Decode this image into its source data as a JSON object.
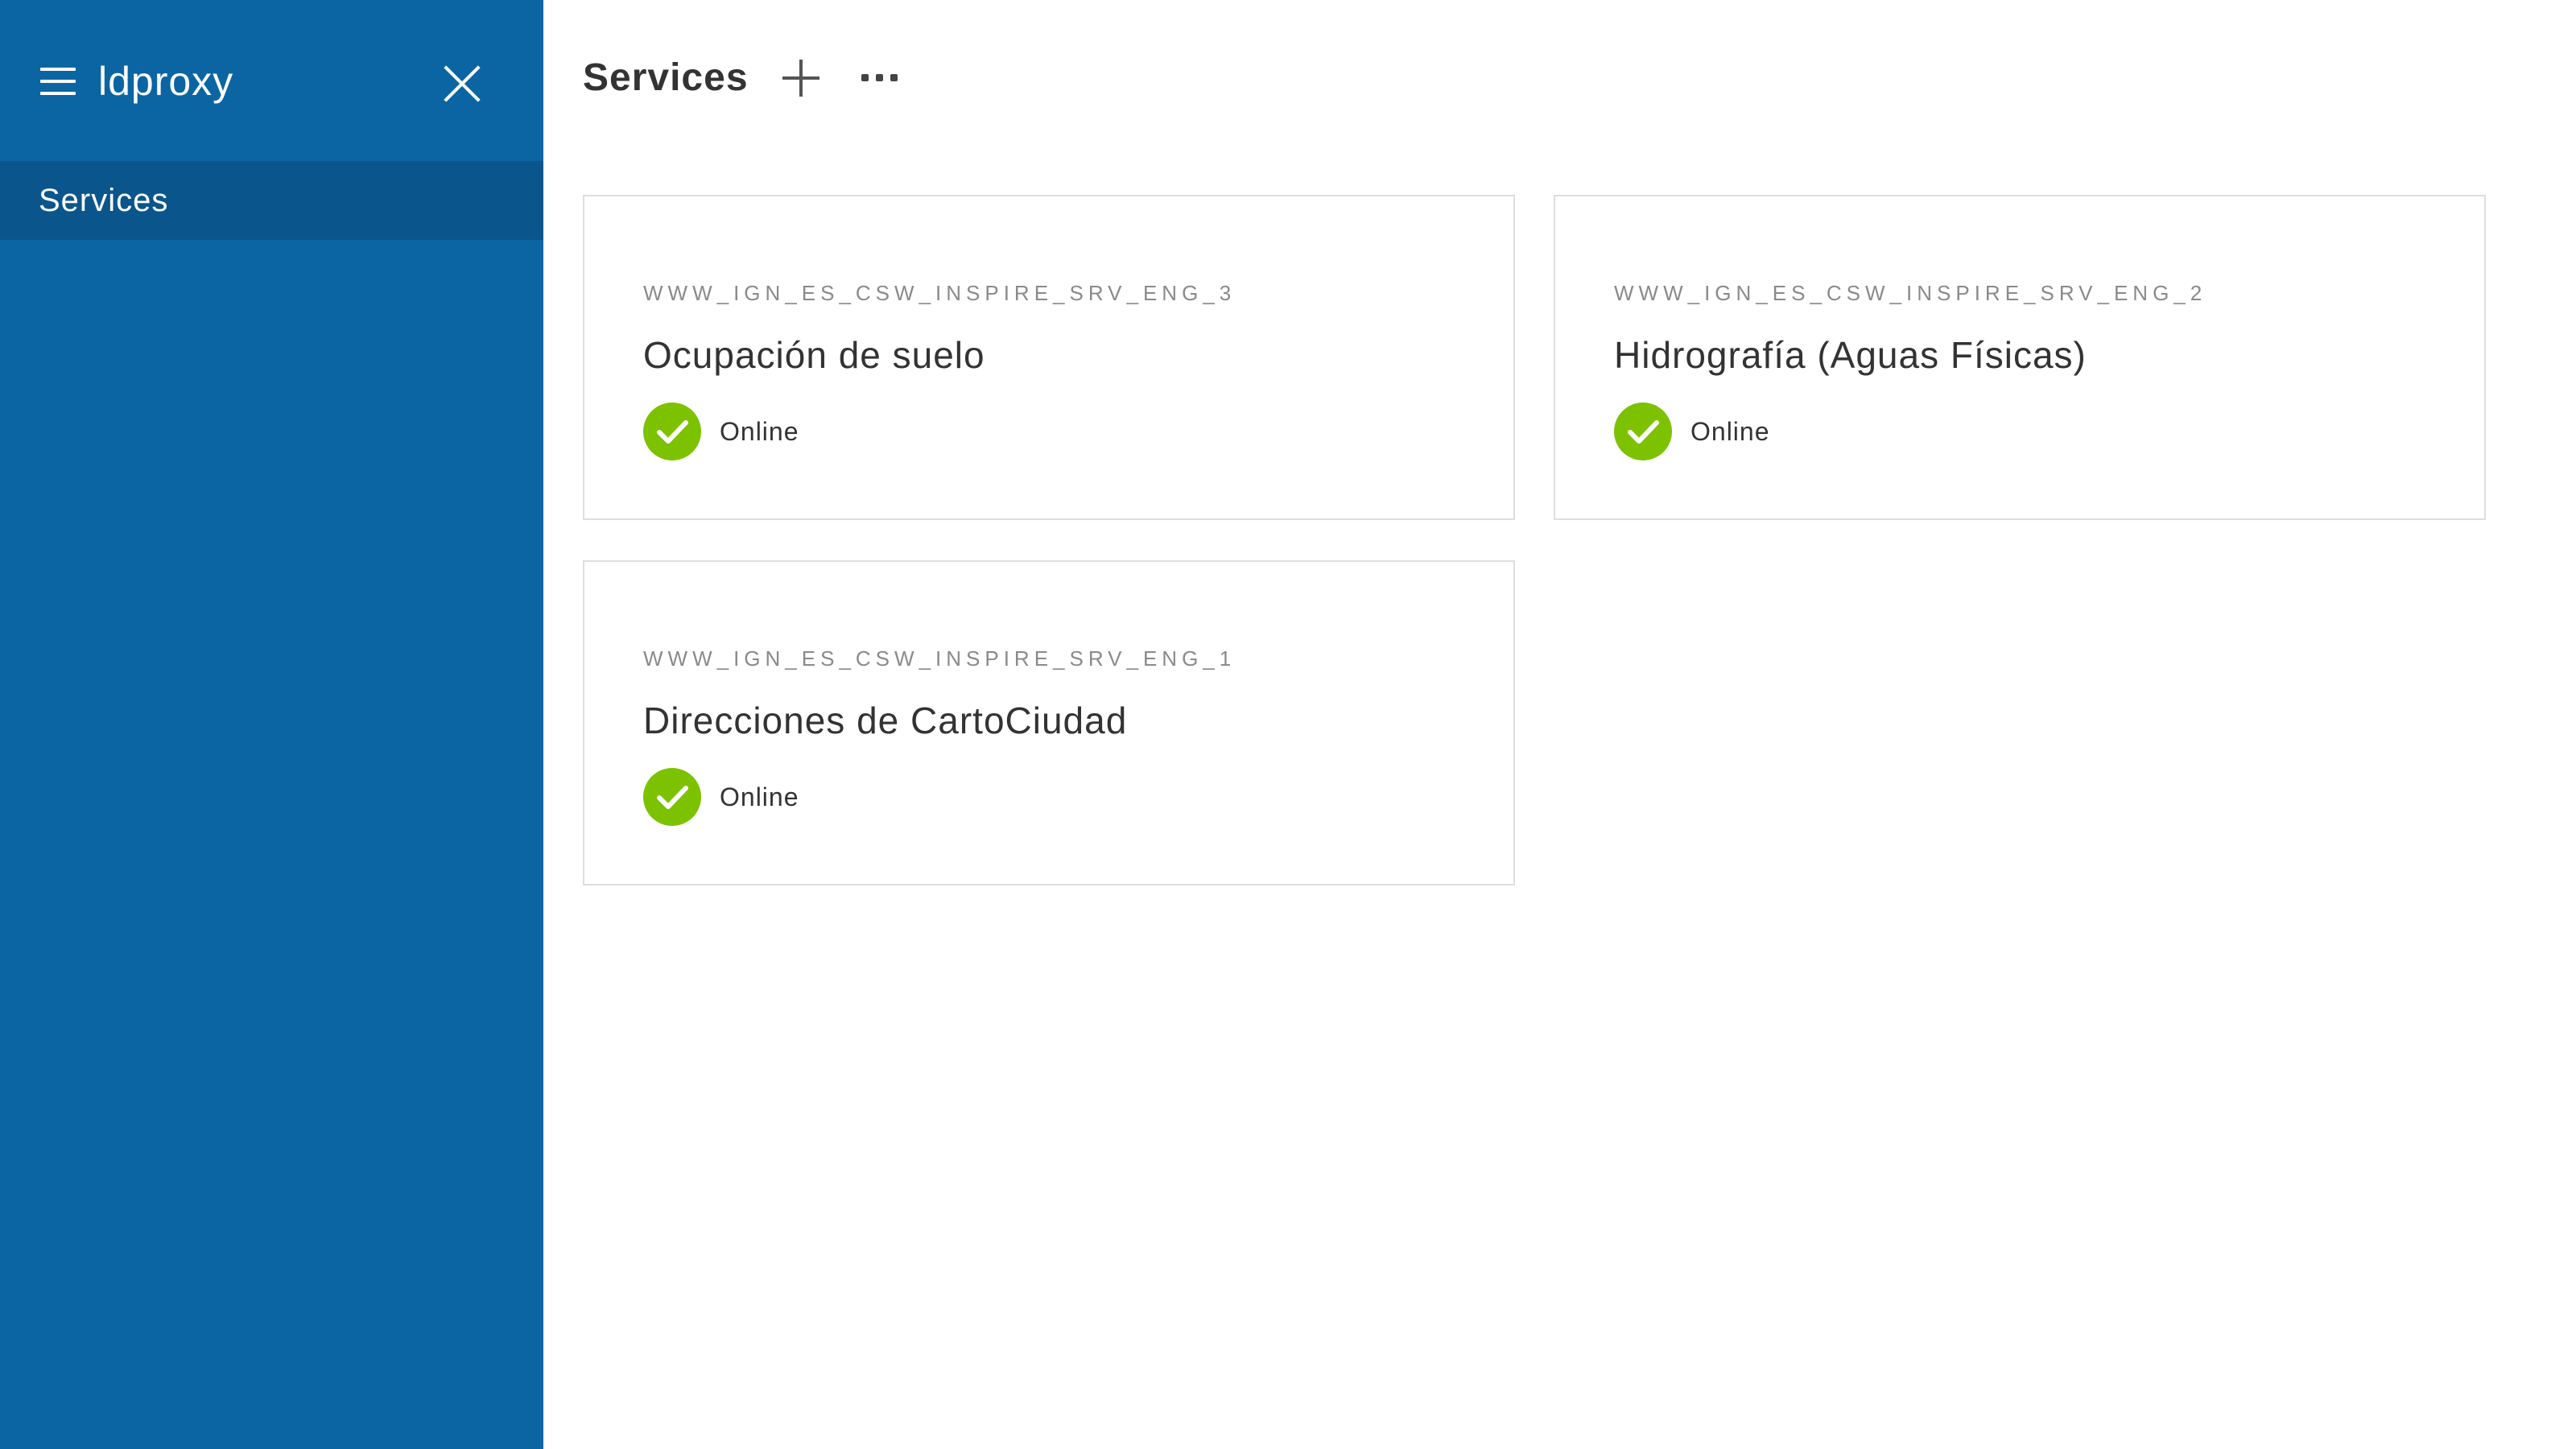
{
  "sidebar": {
    "app_title": "ldproxy",
    "items": [
      {
        "label": "Services",
        "active": true
      }
    ],
    "background_color": "#0b65a3",
    "active_item_color": "#0a568c"
  },
  "header": {
    "title": "Services",
    "icons": [
      "plus-icon",
      "more-horizontal-icon"
    ]
  },
  "services": [
    {
      "id": "WWW_IGN_ES_CSW_INSPIRE_SRV_ENG_3",
      "title": "Ocupación de suelo",
      "status": "Online"
    },
    {
      "id": "WWW_IGN_ES_CSW_INSPIRE_SRV_ENG_2",
      "title": "Hidrografía (Aguas Físicas)",
      "status": "Online"
    },
    {
      "id": "WWW_IGN_ES_CSW_INSPIRE_SRV_ENG_1",
      "title": "Direcciones de CartoCiudad",
      "status": "Online"
    }
  ],
  "status_color": "#7cc200"
}
